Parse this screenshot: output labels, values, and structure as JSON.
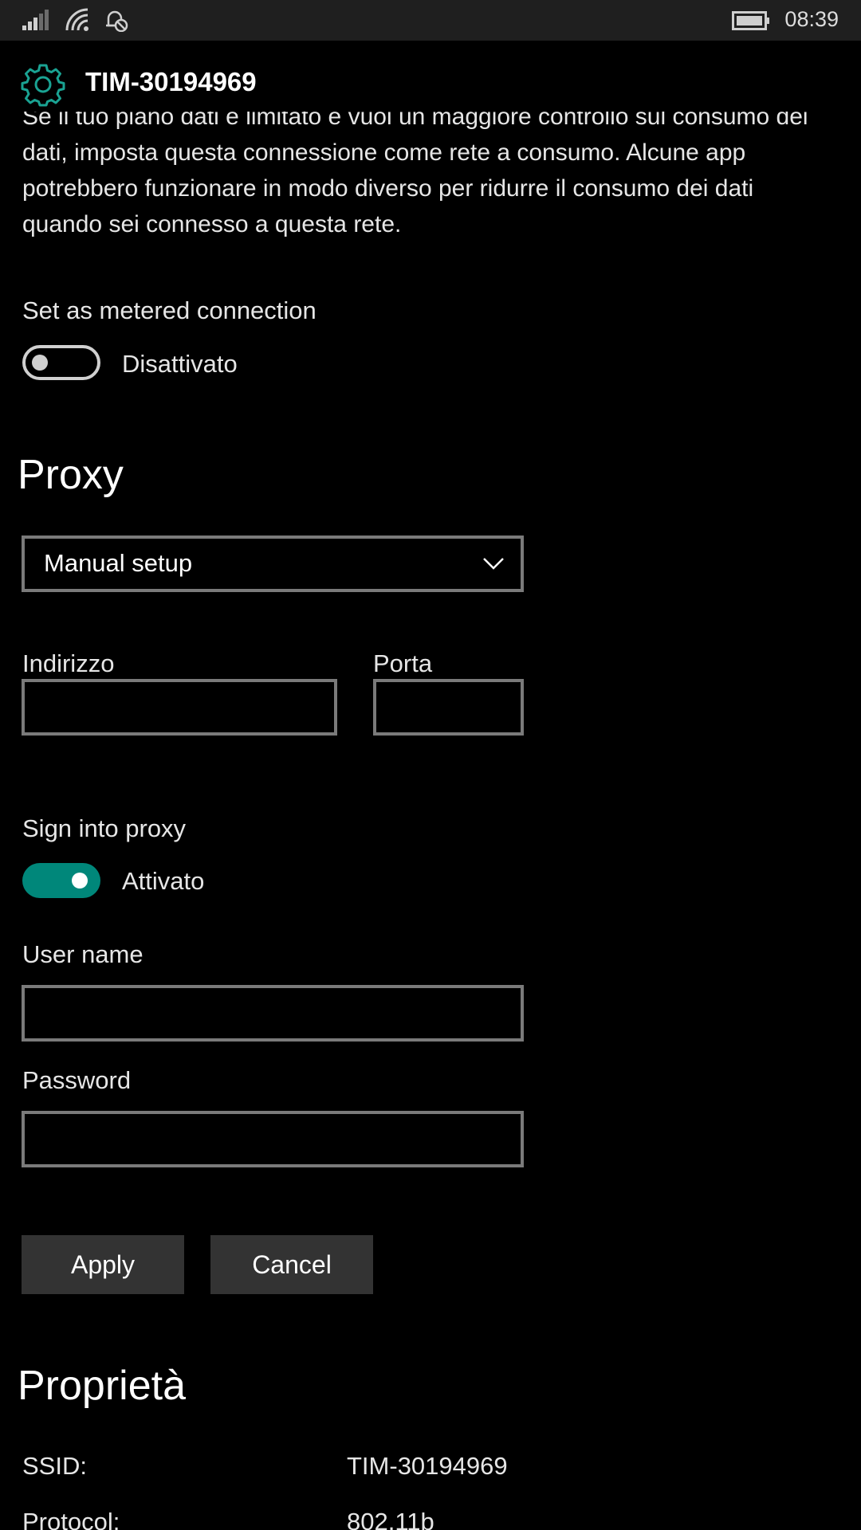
{
  "status_bar": {
    "time": "08:39",
    "icons": [
      "signal-icon",
      "wifi-icon",
      "quiet-hours-icon",
      "battery-icon"
    ]
  },
  "header": {
    "icon": "gear-icon",
    "title": "TIM-30194969"
  },
  "metered": {
    "description": "Se il tuo piano dati è limitato e vuoi un maggiore controllo sul consumo dei dati, imposta questa connessione come rete a consumo. Alcune app potrebbero funzionare in modo diverso per ridurre il consumo dei dati quando sei connesso a questa rete.",
    "label": "Set as metered connection",
    "state": "Disattivato",
    "on": false
  },
  "proxy": {
    "title": "Proxy",
    "mode": "Manual setup",
    "address_label": "Indirizzo",
    "address_value": "",
    "port_label": "Porta",
    "port_value": "",
    "sign_in_label": "Sign into proxy",
    "sign_in_state": "Attivato",
    "sign_in_on": true,
    "username_label": "User name",
    "username_value": "",
    "password_label": "Password",
    "password_value": "",
    "apply_label": "Apply",
    "cancel_label": "Cancel"
  },
  "properties": {
    "title": "Proprietà",
    "rows": [
      {
        "label": "SSID:",
        "value": "TIM-30194969"
      },
      {
        "label": "Protocol:",
        "value": "802.11b"
      }
    ]
  },
  "colors": {
    "accent": "#00877a",
    "background": "#000000",
    "status_bar": "#1f1f1f",
    "field_border": "#7a7a7a",
    "button": "#333333"
  }
}
